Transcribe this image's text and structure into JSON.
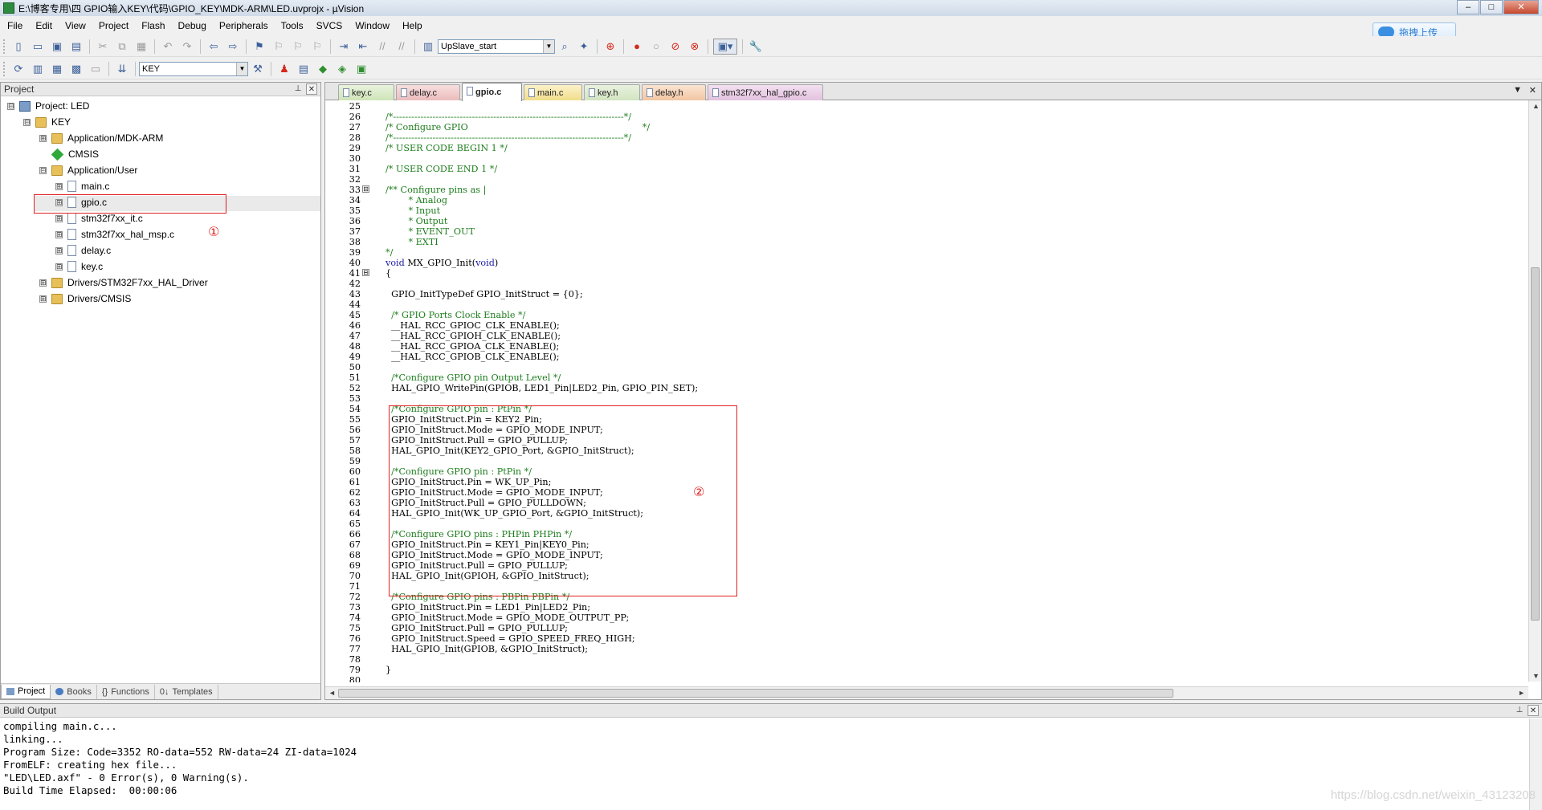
{
  "window": {
    "title": "E:\\博客专用\\四 GPIO输入KEY\\代码\\GPIO_KEY\\MDK-ARM\\LED.uvprojx - µVision",
    "controls": [
      "–",
      "□",
      "✕"
    ]
  },
  "menu": [
    "File",
    "Edit",
    "View",
    "Project",
    "Flash",
    "Debug",
    "Peripherals",
    "Tools",
    "SVCS",
    "Window",
    "Help"
  ],
  "upload_button": "拖拽上传",
  "toolbar1": {
    "debug_combo": "UpSlave_start"
  },
  "toolbar2": {
    "target_combo": "KEY"
  },
  "project_panel": {
    "title": "Project",
    "tree": [
      {
        "label": "Project: LED",
        "level": 0,
        "icon": "project-icon",
        "expander": "⊟"
      },
      {
        "label": "KEY",
        "level": 1,
        "icon": "folder-icon",
        "expander": "⊟"
      },
      {
        "label": "Application/MDK-ARM",
        "level": 2,
        "icon": "folder-icon",
        "expander": "⊞"
      },
      {
        "label": "CMSIS",
        "level": 2,
        "icon": "diamond-icon",
        "expander": ""
      },
      {
        "label": "Application/User",
        "level": 2,
        "icon": "folder-icon",
        "expander": "⊟"
      },
      {
        "label": "main.c",
        "level": 3,
        "icon": "file-icon",
        "expander": "⊞"
      },
      {
        "label": "gpio.c",
        "level": 3,
        "icon": "file-icon",
        "expander": "⊞"
      },
      {
        "label": "stm32f7xx_it.c",
        "level": 3,
        "icon": "file-icon",
        "expander": "⊞"
      },
      {
        "label": "stm32f7xx_hal_msp.c",
        "level": 3,
        "icon": "file-icon",
        "expander": "⊞"
      },
      {
        "label": "delay.c",
        "level": 3,
        "icon": "file-icon",
        "expander": "⊞"
      },
      {
        "label": "key.c",
        "level": 3,
        "icon": "file-icon",
        "expander": "⊞"
      },
      {
        "label": "Drivers/STM32F7xx_HAL_Driver",
        "level": 2,
        "icon": "folder-icon",
        "expander": "⊞"
      },
      {
        "label": "Drivers/CMSIS",
        "level": 2,
        "icon": "folder-icon",
        "expander": "⊞"
      }
    ],
    "tabs": [
      "Project",
      "Books",
      "Functions",
      "Templates"
    ],
    "annotation_1": "①"
  },
  "editor": {
    "tabs": [
      {
        "label": "key.c",
        "color": "c"
      },
      {
        "label": "delay.c",
        "color": "r"
      },
      {
        "label": "gpio.c",
        "color": "y",
        "active": true
      },
      {
        "label": "main.c",
        "color": "y"
      },
      {
        "label": "key.h",
        "color": "g"
      },
      {
        "label": "delay.h",
        "color": "o"
      },
      {
        "label": "stm32f7xx_hal_gpio.c",
        "color": "p"
      }
    ],
    "annotation_2": "②",
    "lines": [
      {
        "n": "25",
        "t": "",
        "c": false
      },
      {
        "n": "26",
        "t": "/*----------------------------------------------------------------------------*/",
        "c": true
      },
      {
        "n": "27",
        "t": "/* Configure GPIO                                                             */",
        "c": true
      },
      {
        "n": "28",
        "t": "/*----------------------------------------------------------------------------*/",
        "c": true
      },
      {
        "n": "29",
        "t": "/* USER CODE BEGIN 1 */",
        "c": true
      },
      {
        "n": "30",
        "t": "",
        "c": false
      },
      {
        "n": "31",
        "t": "/* USER CODE END 1 */",
        "c": true
      },
      {
        "n": "32",
        "t": "",
        "c": false
      },
      {
        "n": "33",
        "t": "/** Configure pins as |",
        "c": true,
        "fold": "⊟"
      },
      {
        "n": "34",
        "t": "        * Analog",
        "c": true
      },
      {
        "n": "35",
        "t": "        * Input",
        "c": true
      },
      {
        "n": "36",
        "t": "        * Output",
        "c": true
      },
      {
        "n": "37",
        "t": "        * EVENT_OUT",
        "c": true
      },
      {
        "n": "38",
        "t": "        * EXTI",
        "c": true
      },
      {
        "n": "39",
        "t": "*/",
        "c": true
      },
      {
        "n": "40",
        "t": "void MX_GPIO_Init(void)",
        "c": false,
        "kw": true
      },
      {
        "n": "41",
        "t": "{",
        "c": false,
        "fold": "⊟"
      },
      {
        "n": "42",
        "t": "",
        "c": false
      },
      {
        "n": "43",
        "t": "  GPIO_InitTypeDef GPIO_InitStruct = {0};",
        "c": false
      },
      {
        "n": "44",
        "t": "",
        "c": false
      },
      {
        "n": "45",
        "t": "  /* GPIO Ports Clock Enable */",
        "c": true
      },
      {
        "n": "46",
        "t": "  __HAL_RCC_GPIOC_CLK_ENABLE();",
        "c": false
      },
      {
        "n": "47",
        "t": "  __HAL_RCC_GPIOH_CLK_ENABLE();",
        "c": false
      },
      {
        "n": "48",
        "t": "  __HAL_RCC_GPIOA_CLK_ENABLE();",
        "c": false
      },
      {
        "n": "49",
        "t": "  __HAL_RCC_GPIOB_CLK_ENABLE();",
        "c": false
      },
      {
        "n": "50",
        "t": "",
        "c": false
      },
      {
        "n": "51",
        "t": "  /*Configure GPIO pin Output Level */",
        "c": true
      },
      {
        "n": "52",
        "t": "  HAL_GPIO_WritePin(GPIOB, LED1_Pin|LED2_Pin, GPIO_PIN_SET);",
        "c": false
      },
      {
        "n": "53",
        "t": "",
        "c": false
      },
      {
        "n": "54",
        "t": "  /*Configure GPIO pin : PtPin */",
        "c": true
      },
      {
        "n": "55",
        "t": "  GPIO_InitStruct.Pin = KEY2_Pin;",
        "c": false
      },
      {
        "n": "56",
        "t": "  GPIO_InitStruct.Mode = GPIO_MODE_INPUT;",
        "c": false
      },
      {
        "n": "57",
        "t": "  GPIO_InitStruct.Pull = GPIO_PULLUP;",
        "c": false
      },
      {
        "n": "58",
        "t": "  HAL_GPIO_Init(KEY2_GPIO_Port, &GPIO_InitStruct);",
        "c": false
      },
      {
        "n": "59",
        "t": "",
        "c": false
      },
      {
        "n": "60",
        "t": "  /*Configure GPIO pin : PtPin */",
        "c": true
      },
      {
        "n": "61",
        "t": "  GPIO_InitStruct.Pin = WK_UP_Pin;",
        "c": false
      },
      {
        "n": "62",
        "t": "  GPIO_InitStruct.Mode = GPIO_MODE_INPUT;",
        "c": false
      },
      {
        "n": "63",
        "t": "  GPIO_InitStruct.Pull = GPIO_PULLDOWN;",
        "c": false
      },
      {
        "n": "64",
        "t": "  HAL_GPIO_Init(WK_UP_GPIO_Port, &GPIO_InitStruct);",
        "c": false
      },
      {
        "n": "65",
        "t": "",
        "c": false
      },
      {
        "n": "66",
        "t": "  /*Configure GPIO pins : PHPin PHPin */",
        "c": true
      },
      {
        "n": "67",
        "t": "  GPIO_InitStruct.Pin = KEY1_Pin|KEY0_Pin;",
        "c": false
      },
      {
        "n": "68",
        "t": "  GPIO_InitStruct.Mode = GPIO_MODE_INPUT;",
        "c": false
      },
      {
        "n": "69",
        "t": "  GPIO_InitStruct.Pull = GPIO_PULLUP;",
        "c": false
      },
      {
        "n": "70",
        "t": "  HAL_GPIO_Init(GPIOH, &GPIO_InitStruct);",
        "c": false
      },
      {
        "n": "71",
        "t": "",
        "c": false
      },
      {
        "n": "72",
        "t": "  /*Configure GPIO pins : PBPin PBPin */",
        "c": true
      },
      {
        "n": "73",
        "t": "  GPIO_InitStruct.Pin = LED1_Pin|LED2_Pin;",
        "c": false
      },
      {
        "n": "74",
        "t": "  GPIO_InitStruct.Mode = GPIO_MODE_OUTPUT_PP;",
        "c": false
      },
      {
        "n": "75",
        "t": "  GPIO_InitStruct.Pull = GPIO_PULLUP;",
        "c": false
      },
      {
        "n": "76",
        "t": "  GPIO_InitStruct.Speed = GPIO_SPEED_FREQ_HIGH;",
        "c": false
      },
      {
        "n": "77",
        "t": "  HAL_GPIO_Init(GPIOB, &GPIO_InitStruct);",
        "c": false
      },
      {
        "n": "78",
        "t": "",
        "c": false
      },
      {
        "n": "79",
        "t": "}",
        "c": false
      },
      {
        "n": "80",
        "t": "",
        "c": false
      }
    ]
  },
  "build_output": {
    "title": "Build Output",
    "text": "compiling main.c...\nlinking...\nProgram Size: Code=3352 RO-data=552 RW-data=24 ZI-data=1024\nFromELF: creating hex file...\n\"LED\\LED.axf\" - 0 Error(s), 0 Warning(s).\nBuild Time Elapsed:  00:00:06",
    "watermark": "https://blog.csdn.net/weixin_43123208"
  },
  "colors": {
    "comment": "#1e7d1e",
    "keyword": "#1a1aa6",
    "annotation": "#e02020"
  }
}
